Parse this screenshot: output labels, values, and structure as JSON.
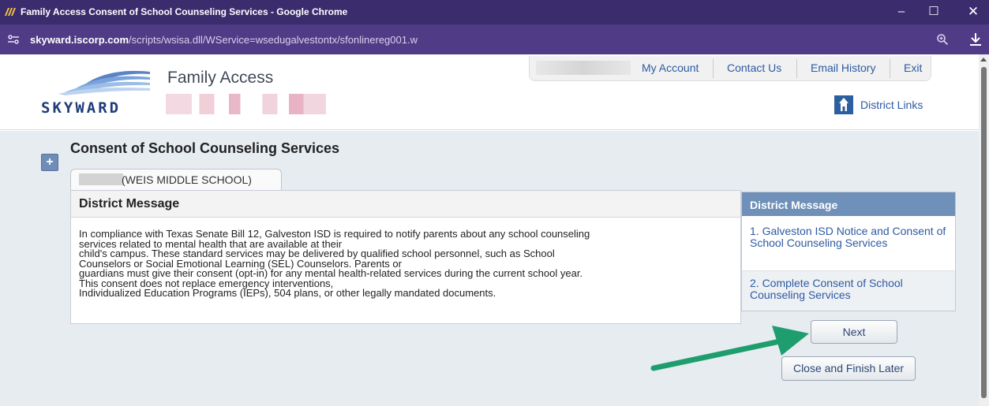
{
  "window": {
    "title": "Family Access Consent of School Counseling Services - Google Chrome",
    "minimize": "–",
    "maximize": "☐",
    "close": "✕"
  },
  "url": {
    "host": "skyward.iscorp.com",
    "path": "/scripts/wsisa.dll/WService=wsedugalvestontx/sfonlinereg001.w"
  },
  "header": {
    "app_name": "Family Access",
    "nav": [
      "My Account",
      "Contact Us",
      "Email History",
      "Exit"
    ],
    "district_links": "District Links"
  },
  "page": {
    "title": "Consent of School Counseling Services",
    "tab_label": "(WEIS MIDDLE SCHOOL)",
    "expand_symbol": "+"
  },
  "message": {
    "heading": "District Message",
    "lines": [
      "In compliance with Texas Senate Bill 12, Galveston ISD is required to notify parents about any school counseling",
      "services related to mental health that are available at their",
      "child's campus. These standard services may be delivered by qualified school personnel, such as School",
      "Counselors or Social Emotional Learning (SEL) Counselors. Parents or",
      "guardians must give their consent (opt-in) for any mental health-related services during the current school year.",
      "This consent does not replace emergency interventions,",
      "Individualized Education Programs (IEPs), 504 plans, or other legally mandated documents."
    ]
  },
  "sidebar": {
    "heading": "District Message",
    "items": [
      "1. Galveston ISD Notice and Consent of School Counseling Services",
      "2. Complete Consent of School Counseling Services"
    ]
  },
  "buttons": {
    "next": "Next",
    "close_finish": "Close and Finish Later"
  },
  "colors": {
    "titlebar": "#3b2c6e",
    "urlbar": "#4f3b86",
    "link": "#2d5aa3",
    "sidebar_header": "#6f90b8",
    "arrow": "#1e9e6e"
  }
}
